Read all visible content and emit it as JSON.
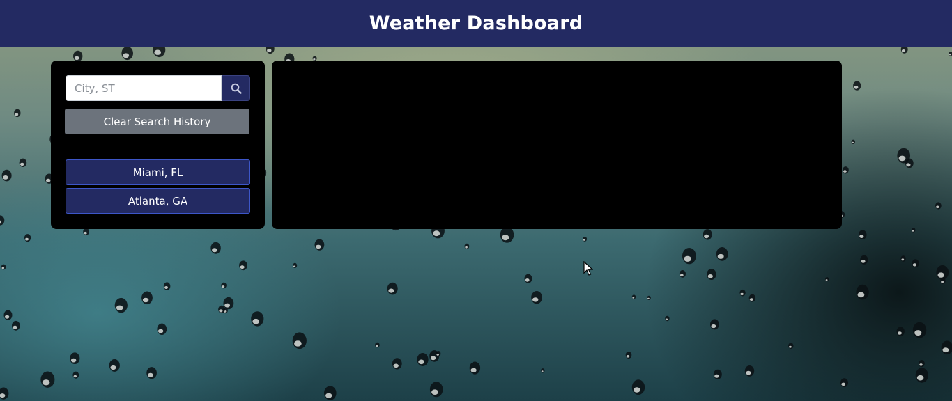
{
  "header": {
    "title": "Weather Dashboard"
  },
  "search": {
    "placeholder": "City, ST",
    "value": "",
    "button_icon": "search-icon"
  },
  "clear_history_label": "Clear Search History",
  "history": [
    {
      "label": "Miami, FL"
    },
    {
      "label": "Atlanta, GA"
    }
  ],
  "colors": {
    "header_bg": "#232a62",
    "panel_bg": "#000000",
    "clear_button": "#6c737c",
    "history_button": "#232a62",
    "history_border": "#3d56c8"
  }
}
